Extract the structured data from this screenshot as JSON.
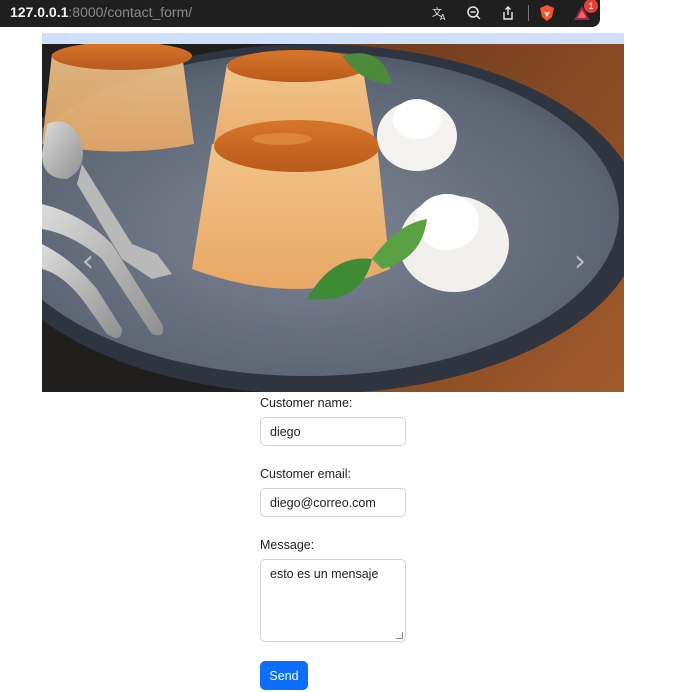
{
  "browser": {
    "url_host": "127.0.0.1",
    "url_rest": ":8000/contact_form/",
    "notification_count": "1"
  },
  "carousel": {
    "prev_icon": "chevron-left-icon",
    "next_icon": "chevron-right-icon"
  },
  "form": {
    "name_label": "Customer name:",
    "name_value": "diego",
    "email_label": "Customer email:",
    "email_value": "diego@correo.com",
    "message_label": "Message:",
    "message_value": "esto es un mensaje",
    "submit_label": "Send"
  },
  "colors": {
    "primary": "#0d6efd",
    "topbar": "#1f1f1f"
  }
}
